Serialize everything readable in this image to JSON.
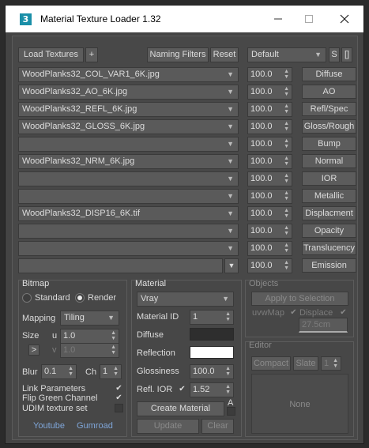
{
  "window": {
    "title": "Material Texture Loader 1.32",
    "icon_glyph": "3"
  },
  "toolbar": {
    "load_textures": "Load Textures",
    "add": "+",
    "naming_filters": "Naming Filters",
    "reset": "Reset",
    "preset": "Default",
    "s": "S",
    "bracket": "[]"
  },
  "rows": [
    {
      "file": "WoodPlanks32_COL_VAR1_6K.jpg",
      "value": "100.0",
      "channel": "Diffuse"
    },
    {
      "file": "WoodPlanks32_AO_6K.jpg",
      "value": "100.0",
      "channel": "AO"
    },
    {
      "file": "WoodPlanks32_REFL_6K.jpg",
      "value": "100.0",
      "channel": "Refl/Spec"
    },
    {
      "file": "WoodPlanks32_GLOSS_6K.jpg",
      "value": "100.0",
      "channel": "Gloss/Rough"
    },
    {
      "file": "",
      "value": "100.0",
      "channel": "Bump"
    },
    {
      "file": "WoodPlanks32_NRM_6K.jpg",
      "value": "100.0",
      "channel": "Normal"
    },
    {
      "file": "",
      "value": "100.0",
      "channel": "IOR"
    },
    {
      "file": "",
      "value": "100.0",
      "channel": "Metallic"
    },
    {
      "file": "WoodPlanks32_DISP16_6K.tif",
      "value": "100.0",
      "channel": "Displacment"
    },
    {
      "file": "",
      "value": "100.0",
      "channel": "Opacity"
    },
    {
      "file": "",
      "value": "100.0",
      "channel": "Translucency"
    },
    {
      "file": "",
      "value": "100.0",
      "channel": "Emission"
    }
  ],
  "bitmap": {
    "title": "Bitmap",
    "standard": "Standard",
    "render": "Render",
    "mapping_label": "Mapping",
    "mapping_value": "Tiling",
    "size_label": "Size",
    "u_label": "u",
    "u_value": "1.0",
    "lock_glyph": ">",
    "v_label": "v",
    "v_value": "1.0",
    "blur_label": "Blur",
    "blur_value": "0.1",
    "ch_label": "Ch",
    "ch_value": "1",
    "link_params": "Link Parameters",
    "flip_green": "Flip Green Channel",
    "udim": "UDIM texture set",
    "youtube": "Youtube",
    "gumroad": "Gumroad"
  },
  "material": {
    "title": "Material",
    "renderer": "Vray",
    "id_label": "Material ID",
    "id_value": "1",
    "diffuse_label": "Diffuse",
    "diffuse_color": "#2e2e2e",
    "reflection_label": "Reflection",
    "reflection_color": "#ffffff",
    "glossiness_label": "Glossiness",
    "glossiness_value": "100.0",
    "ior_label": "Refl. IOR",
    "ior_value": "1.52",
    "create": "Create Material",
    "a": "A",
    "update": "Update",
    "clear": "Clear"
  },
  "objects": {
    "title": "Objects",
    "apply": "Apply to Selection",
    "uvwmap": "uvwMap",
    "displace": "Displace",
    "disp_value": "27.5cm"
  },
  "editor": {
    "title": "Editor",
    "compact": "Compact",
    "slate": "Slate",
    "slot": "1",
    "preview": "None"
  }
}
